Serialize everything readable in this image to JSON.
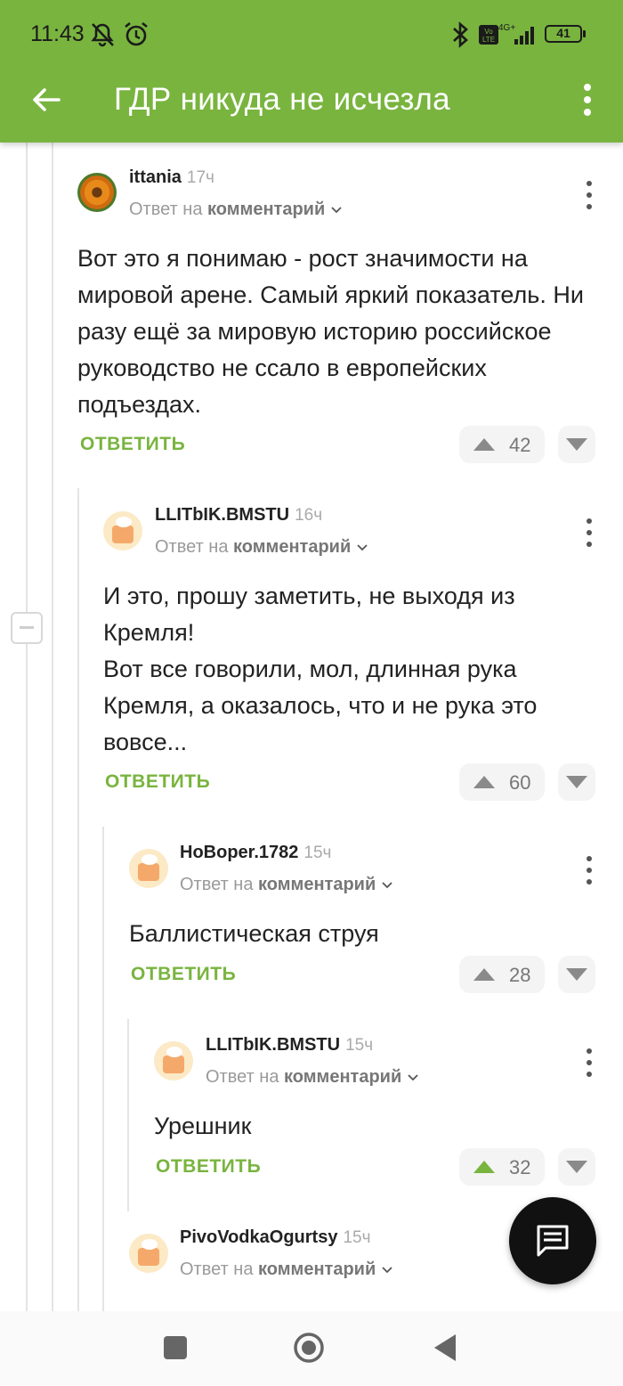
{
  "status_bar": {
    "time": "11:43",
    "battery": "41",
    "network": "4G+"
  },
  "toolbar": {
    "title": "ГДР никуда не исчезла"
  },
  "comments": [
    {
      "author": "ittania",
      "time": "17ч",
      "reply_prefix": "Ответ на",
      "reply_target": "комментарий",
      "text": "Вот это я понимаю - рост значимости на мировой арене. Самый яркий показатель. Ни разу ещё за мировую историю российское руководство не ссало в европейских подъездах.",
      "reply_label": "ОТВЕТИТЬ",
      "rating": "42"
    },
    {
      "author": "LLITbIK.BMSTU",
      "time": "16ч",
      "reply_prefix": "Ответ на",
      "reply_target": "комментарий",
      "text": "И это, прошу заметить, не выходя из Кремля!\nВот все говорили, мол, длинная рука Кремля, а оказалось, что и не рука это вовсе...",
      "reply_label": "ОТВЕТИТЬ",
      "rating": "60"
    },
    {
      "author": "HoBoper.1782",
      "time": "15ч",
      "reply_prefix": "Ответ на",
      "reply_target": "комментарий",
      "text": "Баллистическая струя",
      "reply_label": "ОТВЕТИТЬ",
      "rating": "28"
    },
    {
      "author": "LLITbIK.BMSTU",
      "time": "15ч",
      "reply_prefix": "Ответ на",
      "reply_target": "комментарий",
      "text": "Урешник",
      "reply_label": "ОТВЕТИТЬ",
      "rating": "32"
    },
    {
      "author": "PivoVodkaOgurtsy",
      "time": "15ч",
      "reply_prefix": "Ответ на",
      "reply_target": "комментарий"
    }
  ],
  "colors": {
    "accent": "#79b43f",
    "upvoted": "#79b43f",
    "fab": "#111111"
  }
}
